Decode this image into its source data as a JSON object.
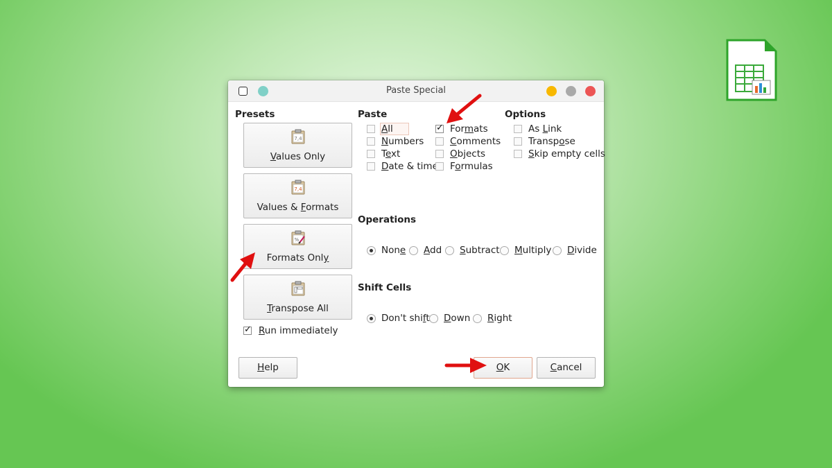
{
  "dialog": {
    "title": "Paste Special",
    "titlebar_colors": {
      "teal": "#80d0c7",
      "minimize": "#f8b800",
      "maximize": "#a9a9a9",
      "close": "#ec5555"
    }
  },
  "presets": {
    "title": "Presets",
    "buttons": [
      {
        "pre": "",
        "ul": "V",
        "post": "alues Only"
      },
      {
        "pre": "Values & ",
        "ul": "F",
        "post": "ormats"
      },
      {
        "pre": "Formats Onl",
        "ul": "y",
        "post": ""
      },
      {
        "pre": "",
        "ul": "T",
        "post": "ranspose All"
      }
    ],
    "run_immediately": {
      "pre": "",
      "ul": "R",
      "post": "un immediately",
      "checked": true
    }
  },
  "paste": {
    "title": "Paste",
    "col1": [
      {
        "pre": "",
        "ul": "A",
        "post": "ll",
        "checked": false
      },
      {
        "pre": "",
        "ul": "N",
        "post": "umbers",
        "checked": false
      },
      {
        "pre": "T",
        "ul": "e",
        "post": "xt",
        "checked": false
      },
      {
        "pre": "",
        "ul": "D",
        "post": "ate & time",
        "checked": false
      }
    ],
    "col2": [
      {
        "pre": "For",
        "ul": "m",
        "post": "ats",
        "checked": true
      },
      {
        "pre": "",
        "ul": "C",
        "post": "omments",
        "checked": false
      },
      {
        "pre": "",
        "ul": "O",
        "post": "bjects",
        "checked": false
      },
      {
        "pre": "F",
        "ul": "o",
        "post": "rmulas",
        "checked": false
      }
    ]
  },
  "options": {
    "title": "Options",
    "items": [
      {
        "pre": "As ",
        "ul": "L",
        "post": "ink",
        "checked": false
      },
      {
        "pre": "Transp",
        "ul": "o",
        "post": "se",
        "checked": false
      },
      {
        "pre": "",
        "ul": "S",
        "post": "kip empty cells",
        "checked": false
      }
    ]
  },
  "operations": {
    "title": "Operations",
    "items": [
      {
        "pre": "Non",
        "ul": "e",
        "post": "",
        "selected": true
      },
      {
        "pre": "",
        "ul": "A",
        "post": "dd",
        "selected": false
      },
      {
        "pre": "",
        "ul": "S",
        "post": "ubtract",
        "selected": false
      },
      {
        "pre": "",
        "ul": "M",
        "post": "ultiply",
        "selected": false
      },
      {
        "pre": "",
        "ul": "D",
        "post": "ivide",
        "selected": false
      }
    ]
  },
  "shift_cells": {
    "title": "Shift Cells",
    "items": [
      {
        "pre": "Don't shi",
        "ul": "f",
        "post": "t",
        "selected": true
      },
      {
        "pre": "",
        "ul": "D",
        "post": "own",
        "selected": false
      },
      {
        "pre": "",
        "ul": "R",
        "post": "ight",
        "selected": false
      }
    ]
  },
  "buttons": {
    "help": {
      "pre": "",
      "ul": "H",
      "post": "elp"
    },
    "ok": {
      "pre": "",
      "ul": "O",
      "post": "K"
    },
    "cancel": {
      "pre": "",
      "ul": "C",
      "post": "ancel"
    }
  },
  "annotation_color": "#e01010"
}
